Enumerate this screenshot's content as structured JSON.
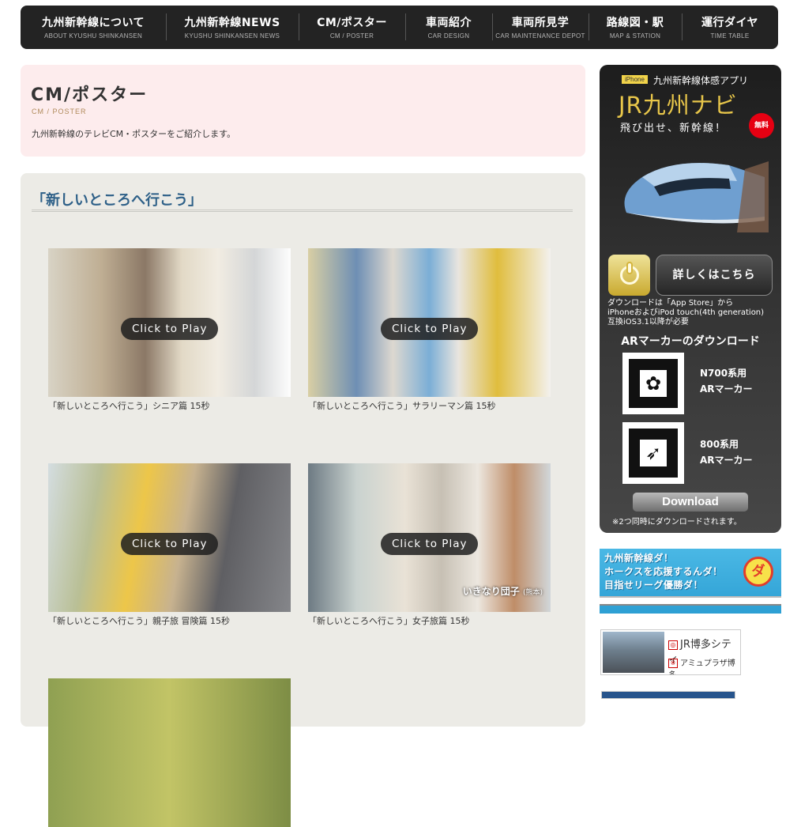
{
  "nav": [
    {
      "jp": "九州新幹線について",
      "en": "ABOUT KYUSHU SHINKANSEN"
    },
    {
      "jp": "九州新幹線NEWS",
      "en": "KYUSHU SHINKANSEN NEWS"
    },
    {
      "jp": "CM/ポスター",
      "en": "CM / POSTER"
    },
    {
      "jp": "車両紹介",
      "en": "CAR DESIGN"
    },
    {
      "jp": "車両所見学",
      "en": "CAR MAINTENANCE DEPOT"
    },
    {
      "jp": "路線図・駅",
      "en": "MAP & STATION"
    },
    {
      "jp": "運行ダイヤ",
      "en": "TIME TABLE"
    }
  ],
  "page": {
    "title": "CM/ポスター",
    "subtitle": "CM / POSTER",
    "description": "九州新幹線のテレビCM・ポスターをご紹介します。"
  },
  "section": {
    "title": "「新しいところへ行こう」",
    "play_label": "Click to Play",
    "videos": [
      {
        "caption": "「新しいところへ行こう」シニア篇 15秒"
      },
      {
        "caption": "「新しいところへ行こう」サラリーマン篇 15秒"
      },
      {
        "caption": "「新しいところへ行こう」親子旅 冒険篇 15秒"
      },
      {
        "caption": "「新しいところへ行こう」女子旅篇 15秒",
        "overlay": "いきなり団子",
        "overlay_small": "(熊本)"
      }
    ]
  },
  "app_banner": {
    "badge": "iPhone",
    "app_label": "九州新幹線体感アプリ",
    "logo": "JR九州ナビ",
    "slogan": "飛び出せ、新幹線！",
    "free": "無料",
    "detail_button": "詳しくはこちら",
    "download_note": [
      "ダウンロードは「App Store」から",
      "iPhoneおよびiPod touch(4th generation)",
      "互換iOS3.1以降が必要"
    ],
    "ar_heading": "ARマーカーのダウンロード",
    "markers": [
      {
        "line1": "N700系用",
        "line2": "ARマーカー"
      },
      {
        "line1": "800系用",
        "line2": "ARマーカー"
      }
    ],
    "download_button": "Download",
    "bottom_note": "※2つ同時にダウンロードされます。"
  },
  "hawks_banner": {
    "line1": "九州新幹線ダ！",
    "line2": "ホークスを応援するんダ！",
    "line3": "目指せリーグ優勝ダ！",
    "logo": "ダ"
  },
  "hakata_banner": {
    "line1": "JR博多シティ",
    "line2": "アミュプラザ博多"
  }
}
